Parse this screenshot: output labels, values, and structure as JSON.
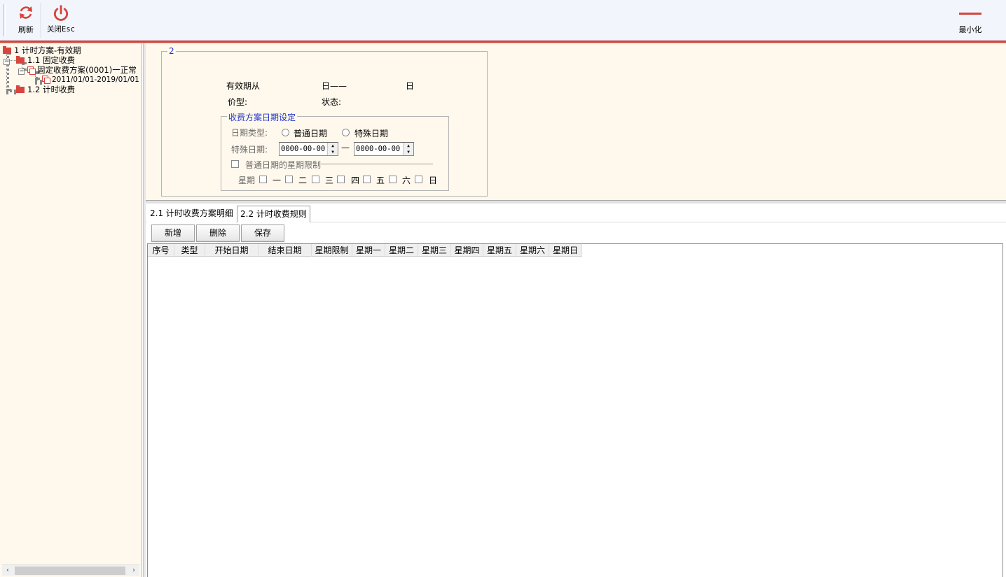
{
  "toolbar": {
    "refresh_label": "刷新",
    "close_label": "关闭Esc",
    "minimize_label": "最小化"
  },
  "tree": {
    "items": [
      {
        "text": "1 计时方案-有效期",
        "level": 0
      },
      {
        "text": "1.1 固定收费",
        "level": 1
      },
      {
        "text": "固定收费方案(0001)一正常",
        "level": 2
      },
      {
        "text": "2011/01/01-2019/01/01",
        "level": 3
      },
      {
        "text": "1.2 计时收费",
        "level": 1
      }
    ],
    "scroll_left": "‹",
    "scroll_right": "›"
  },
  "form": {
    "group_title": "2",
    "valid_from_label": "有效期从",
    "date_sep_label": "日——",
    "date_end_label": "日",
    "price_type_label": "价型:",
    "status_label": "状态:",
    "date_group_title": "收费方案日期设定",
    "date_type_label": "日期类型:",
    "radio_normal": "普通日期",
    "radio_special": "特殊日期",
    "special_date_label": "特殊日期:",
    "start_date_value": "0000-00-00",
    "end_date_value": "0000-00-00",
    "range_sep": "—",
    "weekday_limit_label": "普通日期的星期限制",
    "week_label": "星期",
    "weekdays": [
      "一",
      "二",
      "三",
      "四",
      "五",
      "六",
      "日"
    ]
  },
  "tabs": [
    {
      "label": "2.1 计时收费方案明细",
      "active": true
    },
    {
      "label": "2.2 计时收费规则",
      "active": false
    }
  ],
  "actions": {
    "add_label": "新增",
    "delete_label": "删除",
    "save_label": "保存"
  },
  "grid": {
    "columns": [
      "序号",
      "类型",
      "开始日期",
      "结束日期",
      "星期限制",
      "星期一",
      "星期二",
      "星期三",
      "星期四",
      "星期五",
      "星期六",
      "星期日"
    ],
    "rows": []
  },
  "colors": {
    "accent_red": "#d5453b",
    "panel_bg": "#fff8ec",
    "title_blue": "#2536c9"
  }
}
